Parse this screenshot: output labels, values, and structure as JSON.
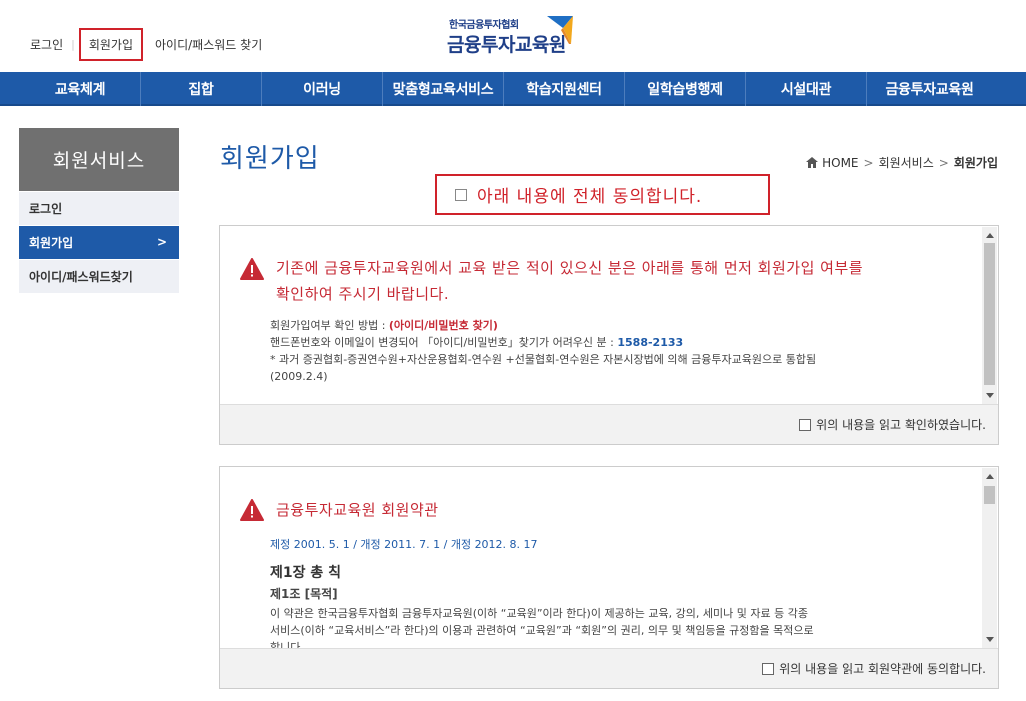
{
  "toplinks": [
    "로그인",
    "회원가입",
    "아이디/패스워드 찾기"
  ],
  "logo": {
    "small": "한국금융투자협회",
    "big": "금융투자교육원"
  },
  "nav": [
    "교육체계",
    "집합",
    "이러닝",
    "맞춤형교육서비스",
    "학습지원센터",
    "일학습병행제",
    "시설대관",
    "금융투자교육원"
  ],
  "sidebar": {
    "title": "회원서비스",
    "items": [
      {
        "label": "로그인"
      },
      {
        "label": "회원가입"
      },
      {
        "label": "아이디/패스워드찾기"
      }
    ]
  },
  "page": {
    "title": "회원가입",
    "breadcrumb": [
      "HOME",
      "회원서비스",
      "회원가입"
    ],
    "agree_all": "아래 내용에 전체 동의합니다."
  },
  "panel1": {
    "heading_line1": "기존에 금융투자교육원에서 교육 받은 적이 있으신 분은 아래를 통해 먼저 회원가입 여부를",
    "heading_line2": "확인하여 주시기 바랍니다.",
    "line1_prefix": "회원가입여부 확인 방법 : ",
    "line1_link": "(아이디/비밀번호 찾기)",
    "line2_prefix": "핸드폰번호와 이메일이 변경되어 「아이디/비밀번호」찾기가 어려우신 분 : ",
    "line2_phone": "1588-2133",
    "line3": "* 과거 증권협회-증권연수원+자산운용협회-연수원 +선물협회-연수원은 자본시장법에 의해 금융투자교육원으로 통합됨",
    "line4": "(2009.2.4)",
    "confirm": "위의 내용을 읽고 확인하였습니다."
  },
  "panel2": {
    "heading": "금융투자교육원 회원약관",
    "revision": "제정 2001. 5. 1 / 개정 2011. 7. 1 / 개정 2012. 8. 17",
    "chapter": "제1장 총 칙",
    "article": "제1조 [목적]",
    "para1": "이 약관은 한국금융투자협회 금융투자교육원(이하 “교육원”이라 한다)이 제공하는 교육, 강의, 세미나 및 자료 등 각종",
    "para2": "서비스(이하 “교육서비스”라 한다)의 이용과 관련하여 “교육원”과 “회원”의 권리, 의무 및 책임등을 규정함을 목적으로",
    "para3": "합니다.",
    "confirm": "위의 내용을 읽고 회원약관에 동의합니다."
  }
}
